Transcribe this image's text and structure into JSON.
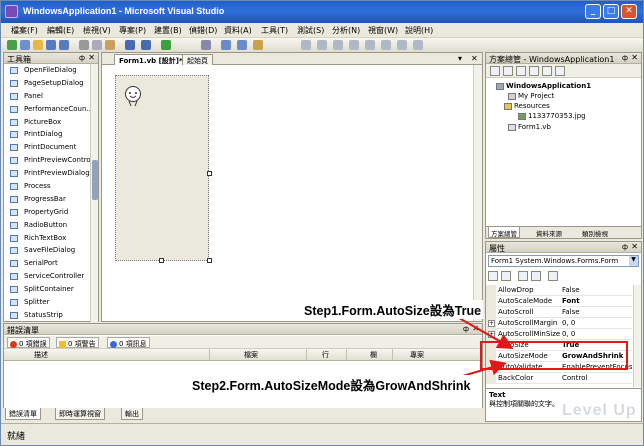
{
  "window": {
    "title": "WindowsApplication1 - Microsoft Visual Studio"
  },
  "menu": [
    {
      "label": "檔案(F)"
    },
    {
      "label": "編輯(E)"
    },
    {
      "label": "檢視(V)"
    },
    {
      "label": "專案(P)"
    },
    {
      "label": "建置(B)"
    },
    {
      "label": "偵錯(D)"
    },
    {
      "label": "資料(A)"
    },
    {
      "label": "工具(T)"
    },
    {
      "label": "測試(S)"
    },
    {
      "label": "分析(N)"
    },
    {
      "label": "視窗(W)"
    },
    {
      "label": "說明(H)"
    }
  ],
  "toolbox": {
    "title": "工具箱",
    "items": [
      {
        "label": "OpenFileDialog"
      },
      {
        "label": "PageSetupDialog"
      },
      {
        "label": "Panel"
      },
      {
        "label": "PerformanceCoun..."
      },
      {
        "label": "PictureBox"
      },
      {
        "label": "PrintDialog"
      },
      {
        "label": "PrintDocument"
      },
      {
        "label": "PrintPreviewControl"
      },
      {
        "label": "PrintPreviewDialog"
      },
      {
        "label": "Process"
      },
      {
        "label": "ProgressBar"
      },
      {
        "label": "PropertyGrid"
      },
      {
        "label": "RadioButton"
      },
      {
        "label": "RichTextBox"
      },
      {
        "label": "SaveFileDialog"
      },
      {
        "label": "SerialPort"
      },
      {
        "label": "ServiceController"
      },
      {
        "label": "SplitContainer"
      },
      {
        "label": "Splitter"
      },
      {
        "label": "StatusStrip"
      }
    ]
  },
  "editor": {
    "tabs": [
      {
        "label": "Form1.vb [設計]*"
      },
      {
        "label": "起始頁"
      }
    ]
  },
  "solution": {
    "title": "方案總管 - WindowsApplication1",
    "tree": [
      {
        "label": "WindowsApplication1"
      },
      {
        "label": "My Project"
      },
      {
        "label": "Resources"
      },
      {
        "label": "1133770353.jpg"
      },
      {
        "label": "Form1.vb"
      }
    ],
    "tabs": [
      {
        "label": "方案總管"
      },
      {
        "label": "資料來源"
      },
      {
        "label": "類別檢視"
      }
    ]
  },
  "properties": {
    "title": "屬性",
    "object": "Form1  System.Windows.Forms.Form",
    "rows": [
      {
        "name": "AllowDrop",
        "value": "False"
      },
      {
        "name": "AutoScaleMode",
        "value": "Font"
      },
      {
        "name": "AutoScroll",
        "value": "False"
      },
      {
        "name": "AutoScrollMargin",
        "value": "0, 0"
      },
      {
        "name": "AutoScrollMinSize",
        "value": "0, 0"
      },
      {
        "name": "AutoSize",
        "value": "True"
      },
      {
        "name": "AutoSizeMode",
        "value": "GrowAndShrink"
      },
      {
        "name": "AutoValidate",
        "value": "EnablePreventFocusC..."
      },
      {
        "name": "BackColor",
        "value": "Control"
      }
    ],
    "desc_title": "Text",
    "desc_text": "與控制項關聯的文字。"
  },
  "errors": {
    "title": "錯誤清單",
    "filters": [
      {
        "label": "0 項錯誤"
      },
      {
        "label": "0 項警告"
      },
      {
        "label": "0 項訊息"
      }
    ],
    "columns": [
      "描述",
      "檔案",
      "行",
      "欄",
      "專案"
    ]
  },
  "bottom_tabs": [
    {
      "label": "錯誤清單"
    },
    {
      "label": "即時運算視窗"
    },
    {
      "label": "輸出"
    }
  ],
  "status": {
    "text": "就緒"
  },
  "annotations": {
    "step1": "Step1.Form.AutoSize設為True",
    "step2": "Step2.Form.AutoSizeMode設為GrowAndShrink"
  },
  "watermark": "Level Up"
}
